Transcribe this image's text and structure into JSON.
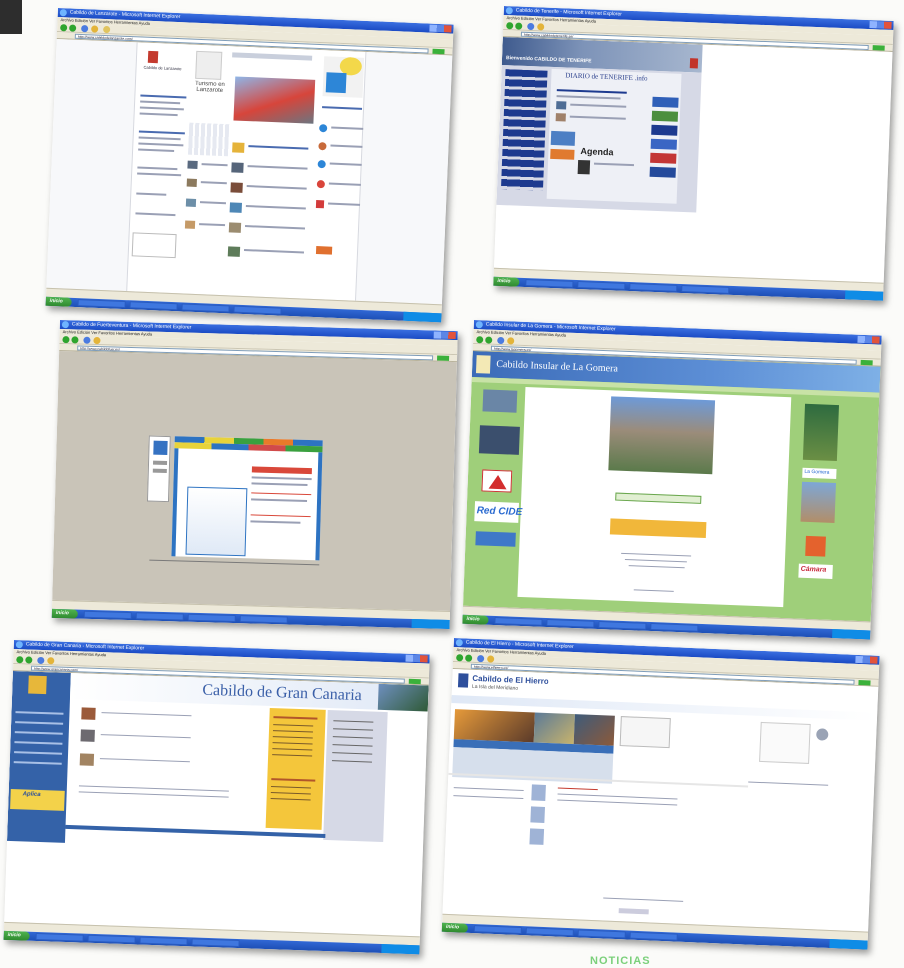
{
  "footer_caption": "NOTICIAS",
  "shots": [
    {
      "title": "Cabildo de Lanzarote - Microsoft Internet Explorer",
      "menu": "Archivo  Edición  Ver  Favoritos  Herramientas  Ayuda",
      "address": "http://www.cabildodelanzarote.com/",
      "site_title": "Turismo en Lanzarote",
      "logo": "Cabildo de Lanzarote"
    },
    {
      "title": "Cabildo de Tenerife - Microsoft Internet Explorer",
      "menu": "Archivo  Edición  Ver  Favoritos  Herramientas  Ayuda",
      "address": "http://www.cabildodetenerife.es/",
      "site_header": "Bienvenido CABILDO DE TENERIFE",
      "diario": "DIARIO de TENERIFE .info",
      "agenda": "Agenda"
    },
    {
      "title": "Cabildo de Fuerteventura - Microsoft Internet Explorer",
      "menu": "Archivo  Edición  Ver  Favoritos  Herramientas  Ayuda",
      "address": "http://www.cabildofuer.es/"
    },
    {
      "title": "Cabildo Insular de La Gomera - Microsoft Internet Explorer",
      "menu": "Archivo  Edición  Ver  Favoritos  Herramientas  Ayuda",
      "address": "http://www.lagomera.es/",
      "site_header": "Cabildo Insular de La Gomera",
      "redcide": "Red CIDE",
      "la_gomera": "La Gomera",
      "camara": "Cámara"
    },
    {
      "title": "Cabildo de Gran Canaria - Microsoft Internet Explorer",
      "menu": "Archivo  Edición  Ver  Favoritos  Herramientas  Ayuda",
      "address": "http://www.grancanaria.com/",
      "site_header": "Cabildo de Gran Canaria",
      "aplica": "Aplica"
    },
    {
      "title": "Cabildo de El Hierro - Microsoft Internet Explorer",
      "menu": "Archivo  Edición  Ver  Favoritos  Herramientas  Ayuda",
      "address": "http://www.elhierro.es/",
      "site_header": "Cabildo de El Hierro",
      "site_subheader": "La Isla del Meridiano"
    }
  ],
  "start_label": "inicio"
}
